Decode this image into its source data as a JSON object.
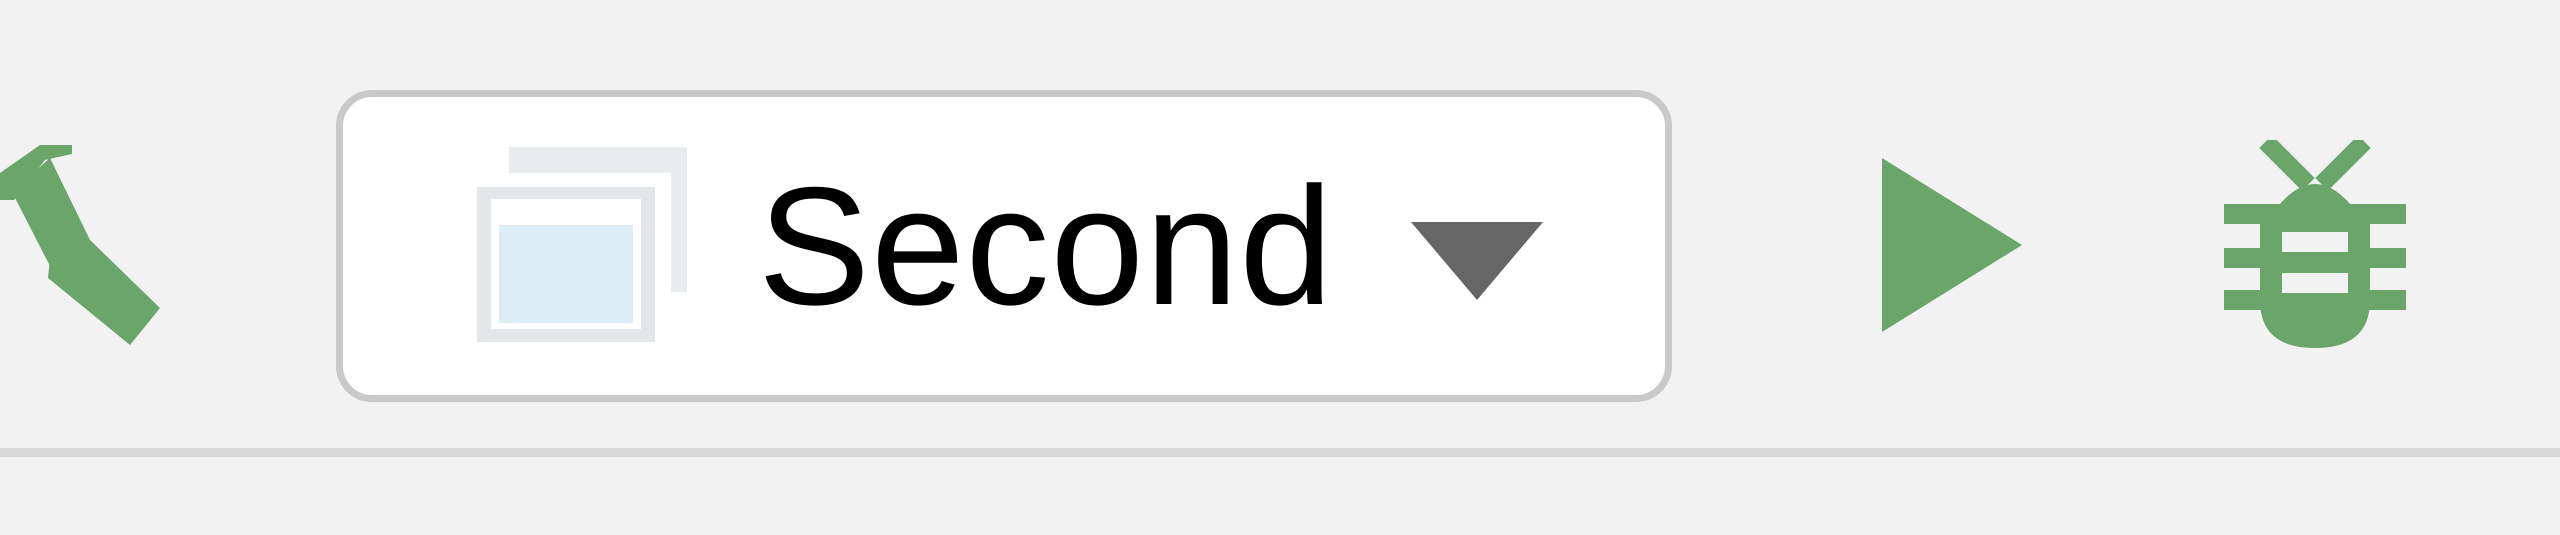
{
  "toolbar": {
    "build_button": {
      "icon": "hammer-icon",
      "color": "#6aa56a"
    },
    "run_configuration": {
      "icon": "application-window-icon",
      "selected": "Second",
      "dropdown_icon": "dropdown-triangle-icon"
    },
    "run_button": {
      "icon": "play-icon",
      "color": "#6aa56a"
    },
    "debug_button": {
      "icon": "bug-icon",
      "color": "#6aa56a"
    }
  }
}
